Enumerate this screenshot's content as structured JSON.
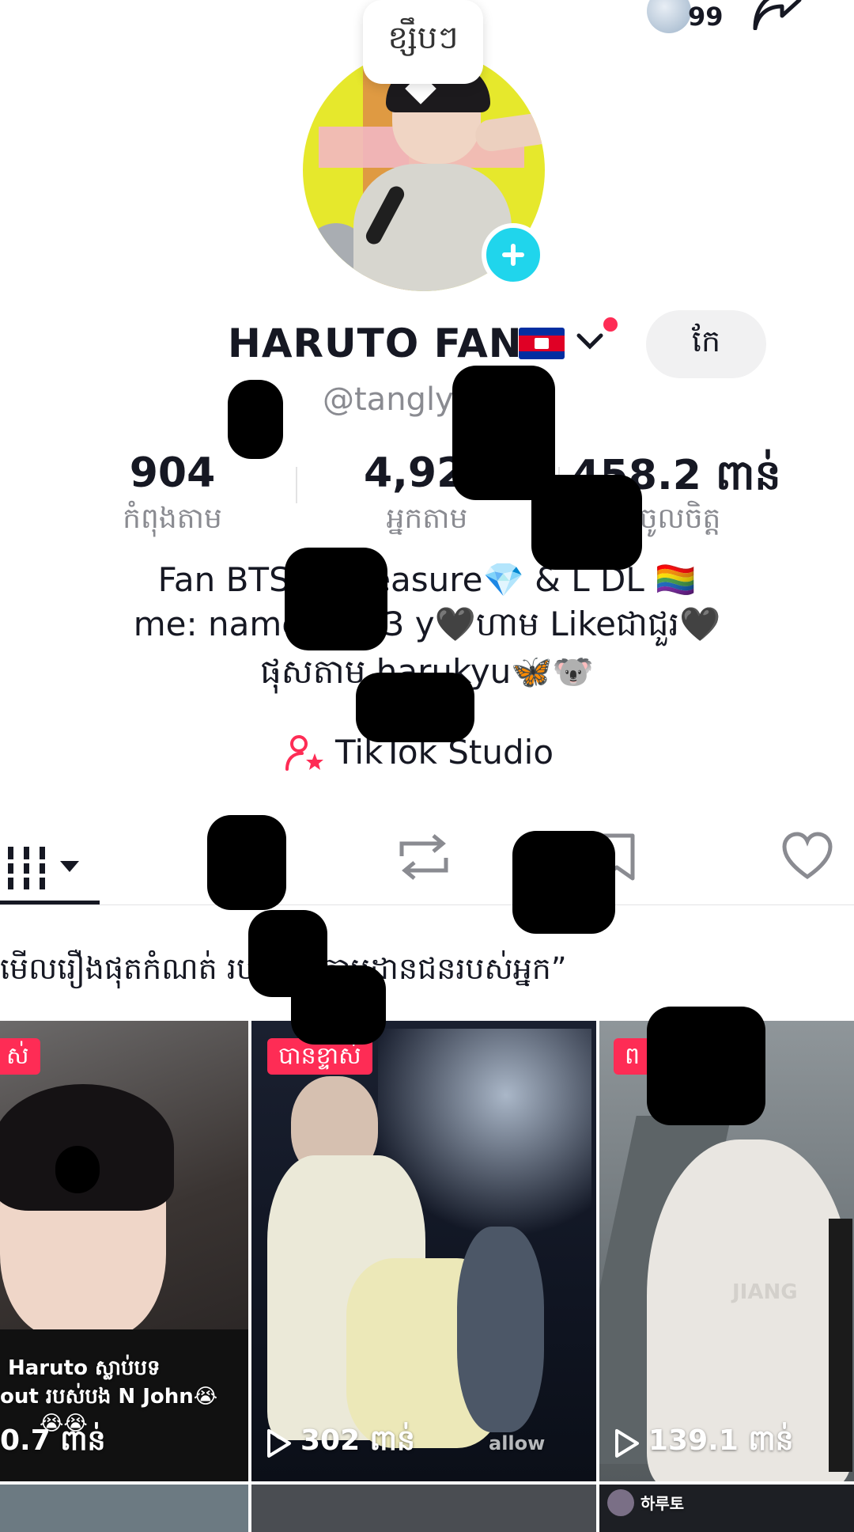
{
  "header": {
    "notification_count": "99"
  },
  "profile": {
    "bubble_text": "ខ្សឹបៗ",
    "display_name": "HARUTO FAN",
    "edit_label": "កែ",
    "username": "@tanglys"
  },
  "stats": [
    {
      "value": "904",
      "label": "កំពុងតាម"
    },
    {
      "value": "4,92",
      "label": "អ្នកតាម"
    },
    {
      "value": "458.2 ពាន់",
      "label": "ចូលចិត្ត"
    }
  ],
  "bio": {
    "line1": "Fan BTS💜 Treasure💎 & L DL 🏳️‍🌈",
    "line2": "me: name: Li 23 y🖤ហាម Likeជាជួរ🖤",
    "line3": "ផុសតាម harukyu🦋🐨"
  },
  "studio_label": "TikTok Studio",
  "tabs": [
    "videos",
    "reposts",
    "favorites",
    "liked"
  ],
  "story_prompt": "មើលរឿងផុតកំណត់ របស់អ្នកតាមដានជនរបស់អ្នក”",
  "videos": [
    {
      "badge": "ស់",
      "views": "0.7 ពាន់",
      "caption_line1": "Haruto ស្លាប់បទ",
      "caption_line2": "out របស់បង N John😭",
      "caption_line3": "😭😭"
    },
    {
      "badge": "បានខ្ទាស់",
      "views": "302 ពាន់",
      "watermark": "allow"
    },
    {
      "badge": "ព",
      "views": "139.1 ពាន់",
      "hoodie_text": "JIANG"
    }
  ],
  "next_row_label": "하루토",
  "colors": {
    "accent": "#fe2c55",
    "add_badge": "#20d5ec",
    "text": "#161823",
    "secondary": "#8a8b91"
  }
}
